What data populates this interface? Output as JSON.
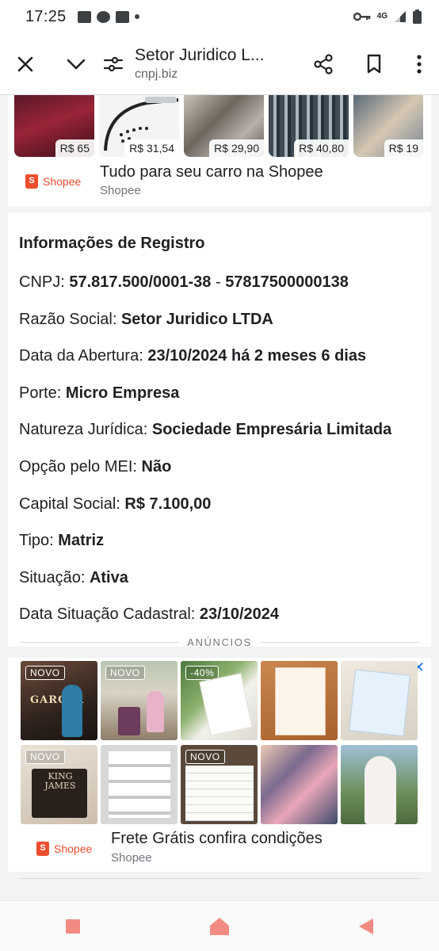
{
  "status_bar": {
    "time": "17:25",
    "network": "4G"
  },
  "toolbar": {
    "title": "Setor Juridico L...",
    "url": "cnpj.biz"
  },
  "ad_top": {
    "prices": [
      "R$ 65",
      "R$ 31,54",
      "R$ 29,90",
      "R$ 40,80",
      "R$ 19"
    ],
    "brand": "Shopee",
    "headline": "Tudo para seu carro na Shopee",
    "advertiser": "Shopee"
  },
  "info": {
    "heading": "Informações de Registro",
    "rows": [
      {
        "label": "CNPJ: ",
        "value": "57.817.500/0001-38",
        "sep": " - ",
        "value2": "57817500000138"
      },
      {
        "label": "Razão Social: ",
        "value": "Setor Juridico LTDA"
      },
      {
        "label": "Data da Abertura: ",
        "value": "23/10/2024 há 2 meses 6 dias"
      },
      {
        "label": "Porte: ",
        "value": "Micro Empresa"
      },
      {
        "label": "Natureza Jurídica: ",
        "value": "Sociedade Empresária Limitada"
      },
      {
        "label": "Opção pelo MEI: ",
        "value": "Não"
      },
      {
        "label": "Capital Social: ",
        "value": "R$ 7.100,00"
      },
      {
        "label": "Tipo: ",
        "value": "Matriz"
      },
      {
        "label": "Situação: ",
        "value": "Ativa"
      },
      {
        "label": "Data Situação Cadastral: ",
        "value": "23/10/2024"
      }
    ]
  },
  "ads_label": "ANÚNCIOS",
  "ad_grid": {
    "badges": [
      "NOVO",
      "NOVO",
      "-40%",
      "",
      "",
      "NOVO",
      "",
      "NOVO",
      "",
      ""
    ],
    "tile_texts": [
      "GAROTA",
      "",
      "",
      "",
      "",
      "KING JAMES",
      "",
      "",
      "",
      ""
    ],
    "brand": "Shopee",
    "headline": "Frete Grátis confira condições",
    "advertiser": "Shopee"
  },
  "colors": {
    "shopee": "#ee4d2d",
    "adchoices": "#1a73e8",
    "nav_icons": "#f28b82"
  }
}
